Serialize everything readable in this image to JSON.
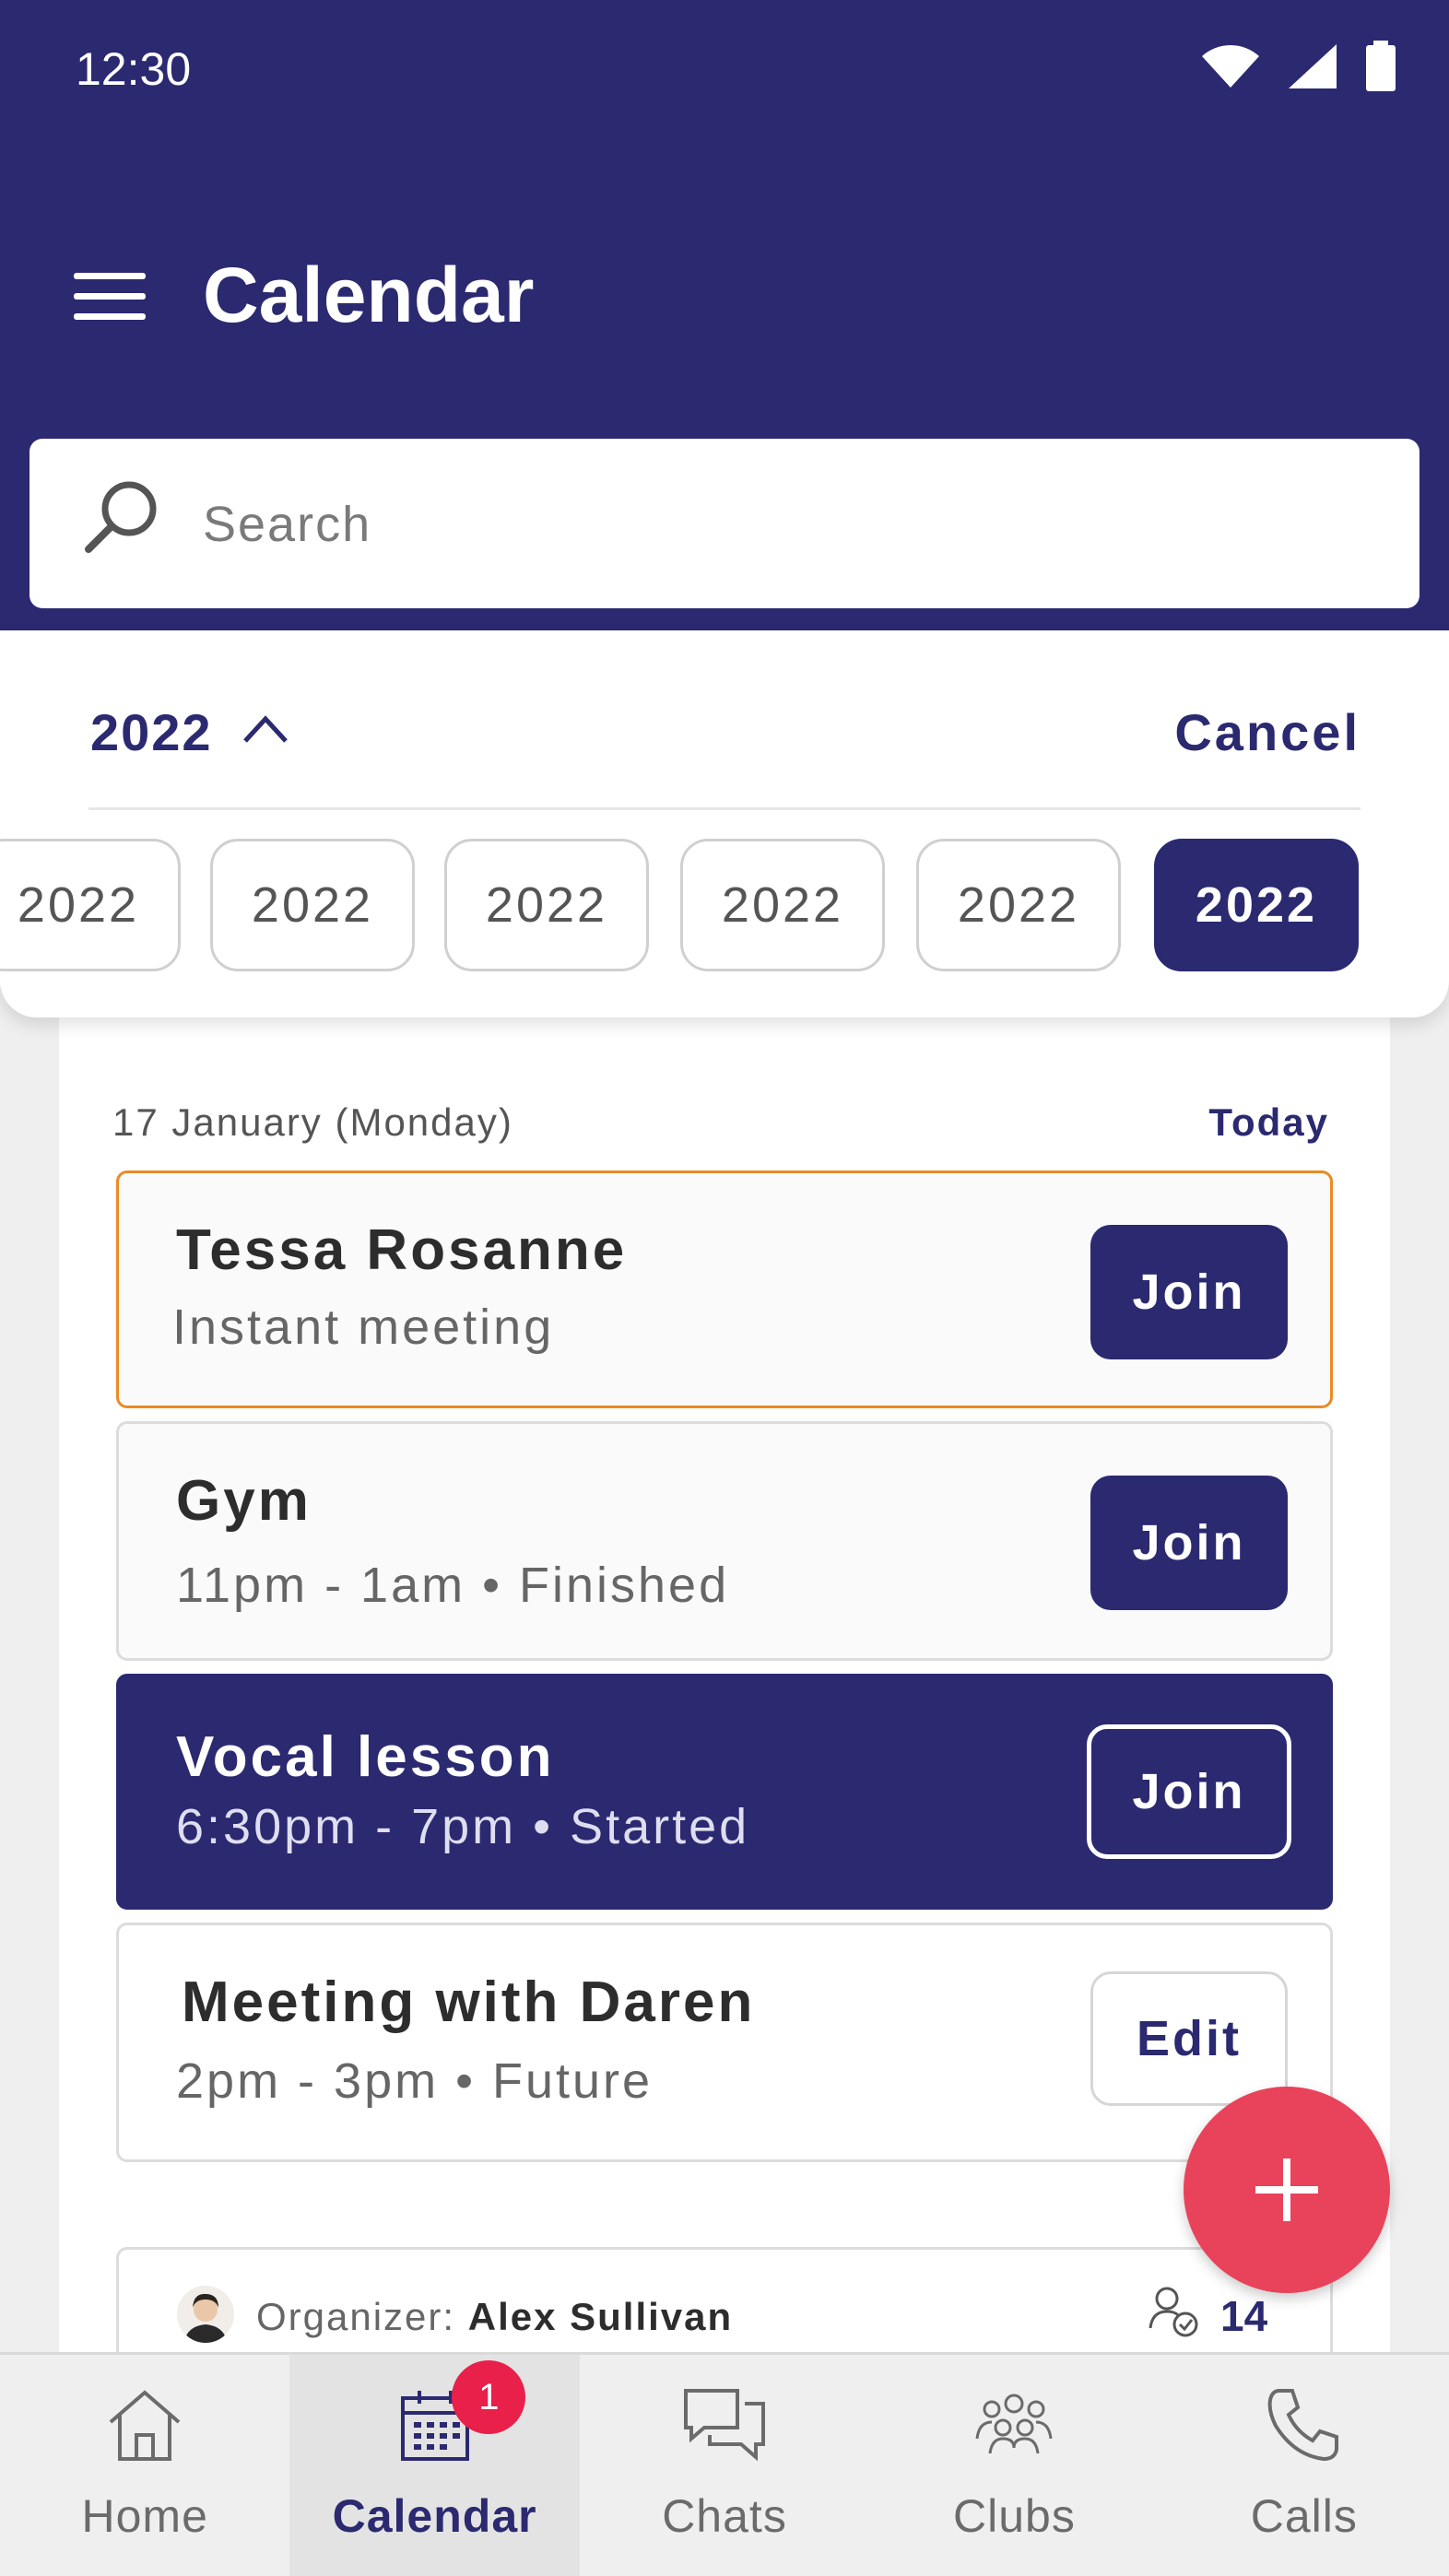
{
  "status_bar": {
    "time": "12:30"
  },
  "header": {
    "title": "Calendar"
  },
  "search": {
    "placeholder": "Search"
  },
  "year_picker": {
    "current": "2022",
    "cancel_label": "Cancel",
    "years": [
      "2022",
      "2022",
      "2022",
      "2022",
      "2022",
      "2022"
    ],
    "selected_index": 5
  },
  "day": {
    "date": "17 January (Monday)",
    "today_label": "Today"
  },
  "events": [
    {
      "title": "Tessa Rosanne",
      "subtitle": "Instant meeting",
      "button": "Join"
    },
    {
      "title": "Gym",
      "subtitle": "11pm - 1am • Finished",
      "button": "Join"
    },
    {
      "title": "Vocal lesson",
      "subtitle": "6:30pm - 7pm • Started",
      "button": "Join"
    },
    {
      "title": "Meeting with Daren",
      "subtitle": "2pm - 3pm • Future",
      "button": "Edit"
    }
  ],
  "organizer": {
    "label": "Organizer:",
    "name": "Alex Sullivan",
    "participants": "14"
  },
  "bottom_nav": {
    "items": [
      {
        "label": "Home",
        "icon": "home-icon"
      },
      {
        "label": "Calendar",
        "icon": "calendar-icon",
        "badge": "1"
      },
      {
        "label": "Chats",
        "icon": "chat-icon"
      },
      {
        "label": "Clubs",
        "icon": "group-icon"
      },
      {
        "label": "Calls",
        "icon": "phone-icon"
      }
    ],
    "active_index": 1
  },
  "colors": {
    "primary": "#2b2970",
    "accent": "#e8435a",
    "highlight_border": "#ec8a25",
    "badge": "#e8204a"
  }
}
